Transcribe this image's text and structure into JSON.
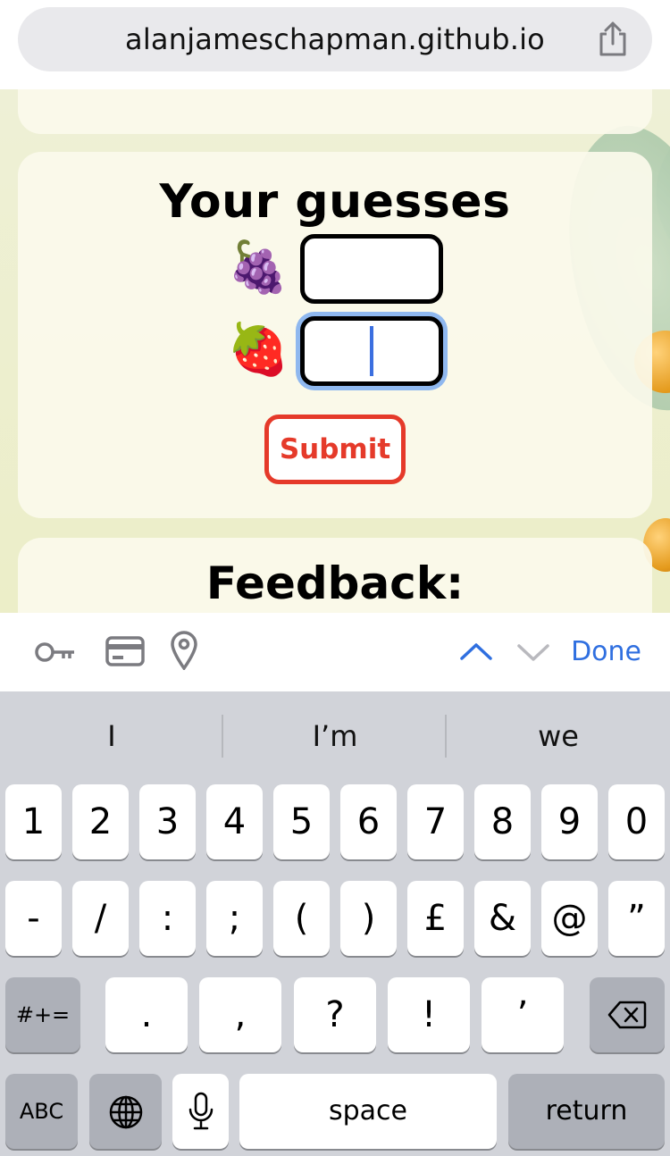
{
  "browser": {
    "url": "alanjameschapman.github.io",
    "share_icon": "share-icon"
  },
  "page": {
    "guesses_title": "Your guesses",
    "inputs": [
      {
        "emoji": "🍇",
        "label": "grapes",
        "value": ""
      },
      {
        "emoji": "🍓",
        "label": "strawberry",
        "value": ""
      }
    ],
    "submit_label": "Submit",
    "feedback_title": "Feedback:",
    "top_card_emojis": [
      "🍇🍇🍇🍇",
      "🍓"
    ]
  },
  "accessory": {
    "icons": [
      "key-icon",
      "credit-card-icon",
      "location-pin-icon"
    ],
    "prev_icon": "chevron-up-icon",
    "next_icon": "chevron-down-icon",
    "done_label": "Done"
  },
  "keyboard": {
    "suggestions": [
      "I",
      "I’m",
      "we"
    ],
    "row1": [
      "1",
      "2",
      "3",
      "4",
      "5",
      "6",
      "7",
      "8",
      "9",
      "0"
    ],
    "row2": [
      "-",
      "/",
      ":",
      ";",
      "(",
      ")",
      "£",
      "&",
      "@",
      "”"
    ],
    "row3": {
      "symbols": "#+=",
      "keys": [
        ".",
        ",",
        "?",
        "!",
        "’"
      ],
      "backspace_icon": "backspace-icon"
    },
    "row4": {
      "abc": "ABC",
      "globe_icon": "globe-icon",
      "mic_icon": "microphone-icon",
      "space": "space",
      "return": "return"
    }
  }
}
